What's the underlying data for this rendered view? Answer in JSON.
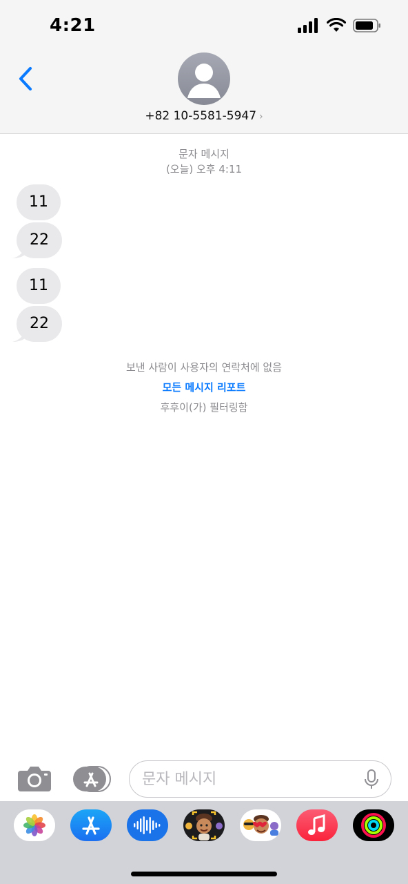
{
  "status_bar": {
    "time": "4:21"
  },
  "header": {
    "contact": "+82 10-5581-5947",
    "chevron": "›"
  },
  "thread": {
    "service": "문자 메시지",
    "timestamp": "(오늘) 오후 4:11",
    "messages": [
      "11",
      "22",
      "11",
      "22"
    ],
    "notice_unknown_sender": "보낸 사람이 사용자의 연락처에 없음",
    "report_link": "모든 메시지 리포트",
    "filtered_by": "후후이(가) 필터링함"
  },
  "composer": {
    "placeholder": "문자 메시지"
  },
  "app_drawer": [
    "photos-icon",
    "app-store-icon",
    "audio-message-icon",
    "memoji-icon",
    "animoji-stickers-icon",
    "music-icon",
    "activity-icon"
  ],
  "colors": {
    "accent": "#0a7aff",
    "bubble": "#e9e9eb",
    "drawer": "#d2d3d8"
  }
}
